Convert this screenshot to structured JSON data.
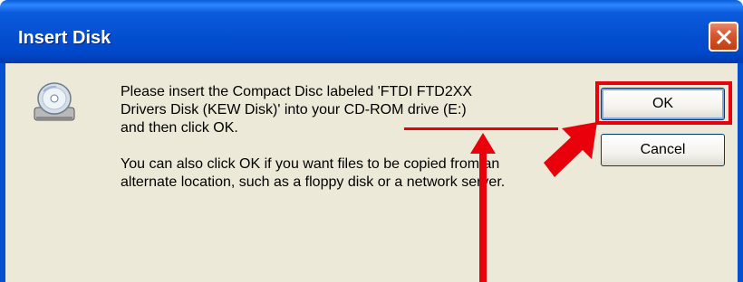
{
  "dialog": {
    "title": "Insert Disk",
    "close_icon": "close-icon",
    "message_line1_parts": [
      "Please insert the Compact Disc labeled 'FTDI FTD2XX",
      "Drivers Disk (KEW Disk)' into your "
    ],
    "drive_text": "CD-ROM drive (E:)",
    "message_line3": "and then click OK.",
    "message_para2": "You can also click OK if you want files to be copied from an alternate location, such as a floppy disk or a network server.",
    "icon": "cd-drive-icon",
    "buttons": {
      "ok_label": "OK",
      "cancel_label": "Cancel"
    }
  },
  "annotations": {
    "color": "#e8000b",
    "ok_highlight": "red-box",
    "drive_underline": "red-underline",
    "arrows": [
      "arrow-up-to-drive",
      "arrow-to-ok"
    ]
  }
}
